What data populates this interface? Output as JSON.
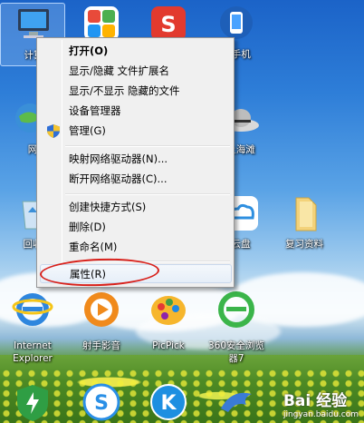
{
  "desktop": {
    "icons": [
      {
        "label": "计算",
        "name": "computer-icon"
      },
      {
        "label": "",
        "name": "app-grid-icon"
      },
      {
        "label": "",
        "name": "sogou-icon"
      },
      {
        "label": "助手机",
        "name": "phone-assistant-icon"
      },
      {
        "label": "网",
        "name": "network-icon"
      },
      {
        "label": "上海滩",
        "name": "shanghai-hat-icon"
      },
      {
        "label": "回收",
        "name": "recycle-bin-icon"
      },
      {
        "label": "云盘",
        "name": "cloud-disk-icon"
      },
      {
        "label": "复习资料",
        "name": "folder-icon"
      },
      {
        "label": "Internet Explorer",
        "name": "ie-icon"
      },
      {
        "label": "射手影音",
        "name": "shooter-player-icon"
      },
      {
        "label": "PicPick",
        "name": "picpick-icon"
      },
      {
        "label": "360安全浏览器7",
        "name": "360-browser-icon"
      },
      {
        "label": "",
        "name": "shield-app-icon"
      },
      {
        "label": "",
        "name": "sogou-s-icon"
      },
      {
        "label": "",
        "name": "k-app-icon"
      },
      {
        "label": "",
        "name": "dolphin-icon"
      }
    ]
  },
  "context_menu": {
    "items": [
      {
        "label": "打开(O)"
      },
      {
        "label": "显示/隐藏 文件扩展名"
      },
      {
        "label": "显示/不显示 隐藏的文件"
      },
      {
        "label": "设备管理器"
      },
      {
        "label": "管理(G)"
      },
      {
        "label": "映射网络驱动器(N)..."
      },
      {
        "label": "断开网络驱动器(C)..."
      },
      {
        "label": "创建快捷方式(S)"
      },
      {
        "label": "删除(D)"
      },
      {
        "label": "重命名(M)"
      },
      {
        "label": "属性(R)"
      }
    ]
  },
  "watermark": {
    "main": "Bai 经验",
    "sub": "jingyan.baidu.com"
  },
  "colors": {
    "highlight_ring": "#d8211b",
    "menu_bg": "#f0f0f0"
  }
}
